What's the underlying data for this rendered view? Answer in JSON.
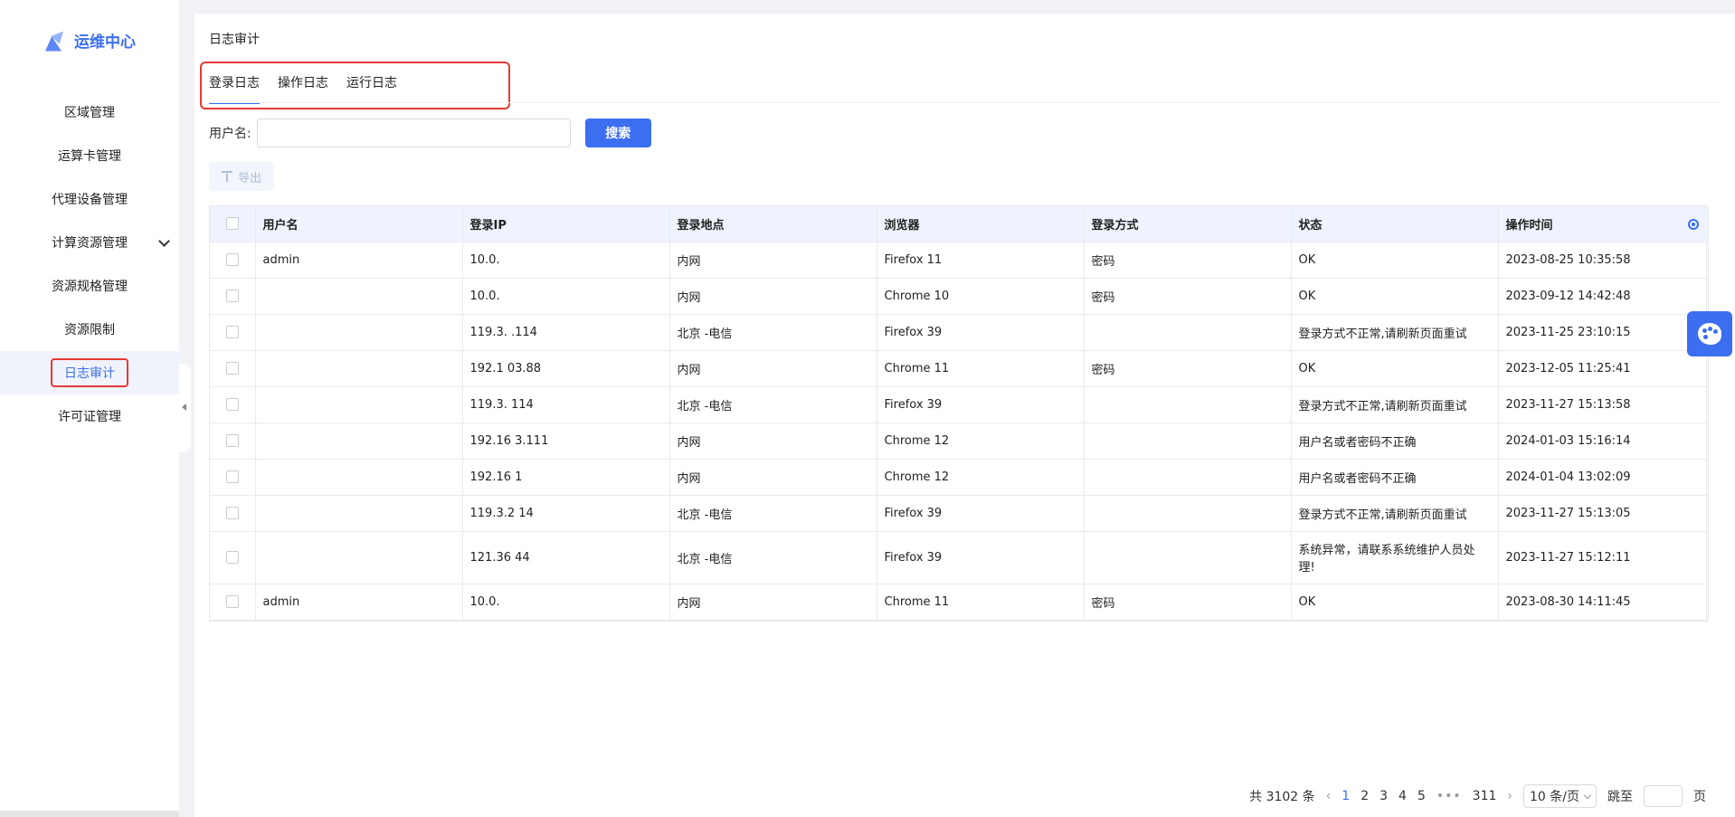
{
  "brand": {
    "name": "运维中心",
    "icon": "logo-icon"
  },
  "sidebar": {
    "items": [
      {
        "label": "区域管理"
      },
      {
        "label": "运算卡管理"
      },
      {
        "label": "代理设备管理"
      },
      {
        "label": "计算资源管理",
        "expandable": true
      },
      {
        "label": "资源规格管理"
      },
      {
        "label": "资源限制"
      },
      {
        "label": "日志审计",
        "active": true
      },
      {
        "label": "许可证管理"
      }
    ]
  },
  "page": {
    "title": "日志审计"
  },
  "tabs": [
    {
      "label": "登录日志",
      "active": true
    },
    {
      "label": "操作日志"
    },
    {
      "label": "运行日志"
    }
  ],
  "search": {
    "label": "用户名:",
    "value": "",
    "placeholder": "",
    "button": "搜索"
  },
  "toolbar": {
    "export_label": "导出"
  },
  "table": {
    "headers": [
      "用户名",
      "登录IP",
      "登录地点",
      "浏览器",
      "登录方式",
      "状态",
      "操作时间"
    ],
    "rows": [
      {
        "user": "admin",
        "ip": "10.0.",
        "location": "内网",
        "browser": "Firefox 11",
        "method": "密码",
        "status": "OK",
        "time": "2023-08-25 10:35:58"
      },
      {
        "user": "",
        "ip": "10.0.",
        "location": "内网",
        "browser": "Chrome 10",
        "method": "密码",
        "status": "OK",
        "time": "2023-09-12 14:42:48"
      },
      {
        "user": "",
        "ip": "119.3.  .114",
        "location": "北京   -电信",
        "browser": "Firefox 39",
        "method": "",
        "status": "登录方式不正常,请刷新页面重试",
        "time": "2023-11-25 23:10:15"
      },
      {
        "user": "",
        "ip": "192.1  03.88",
        "location": "内网",
        "browser": "Chrome 11",
        "method": "密码",
        "status": "OK",
        "time": "2023-12-05 11:25:41"
      },
      {
        "user": "",
        "ip": "119.3.  114",
        "location": "北京   -电信",
        "browser": "Firefox 39",
        "method": "",
        "status": "登录方式不正常,请刷新页面重试",
        "time": "2023-11-27 15:13:58"
      },
      {
        "user": "",
        "ip": "192.16  3.111",
        "location": "内网",
        "browser": "Chrome 12",
        "method": "",
        "status": "用户名或者密码不正确",
        "time": "2024-01-03 15:16:14"
      },
      {
        "user": "",
        "ip": "192.16  1",
        "location": "内网",
        "browser": "Chrome 12",
        "method": "",
        "status": "用户名或者密码不正确",
        "time": "2024-01-04 13:02:09"
      },
      {
        "user": "",
        "ip": "119.3.2  14",
        "location": "北京   -电信",
        "browser": "Firefox 39",
        "method": "",
        "status": "登录方式不正常,请刷新页面重试",
        "time": "2023-11-27 15:13:05"
      },
      {
        "user": "",
        "ip": "121.36  44",
        "location": "北京   -电信",
        "browser": "Firefox 39",
        "method": "",
        "status": "系统异常，请联系系统维护人员处理!",
        "time": "2023-11-27 15:12:11"
      },
      {
        "user": "admin",
        "ip": "10.0.",
        "location": "内网",
        "browser": "Chrome 11",
        "method": "密码",
        "status": "OK",
        "time": "2023-08-30 14:11:45"
      }
    ]
  },
  "pagination": {
    "total_label": "共 3102 条",
    "pages": [
      "1",
      "2",
      "3",
      "4",
      "5"
    ],
    "active_page": "1",
    "dots": "•••",
    "last_page": "311",
    "page_size": "10 条/页",
    "jump_label": "跳至",
    "page_suffix": "页"
  },
  "colors": {
    "accent": "#3c6ef0",
    "highlight": "#e53935"
  }
}
